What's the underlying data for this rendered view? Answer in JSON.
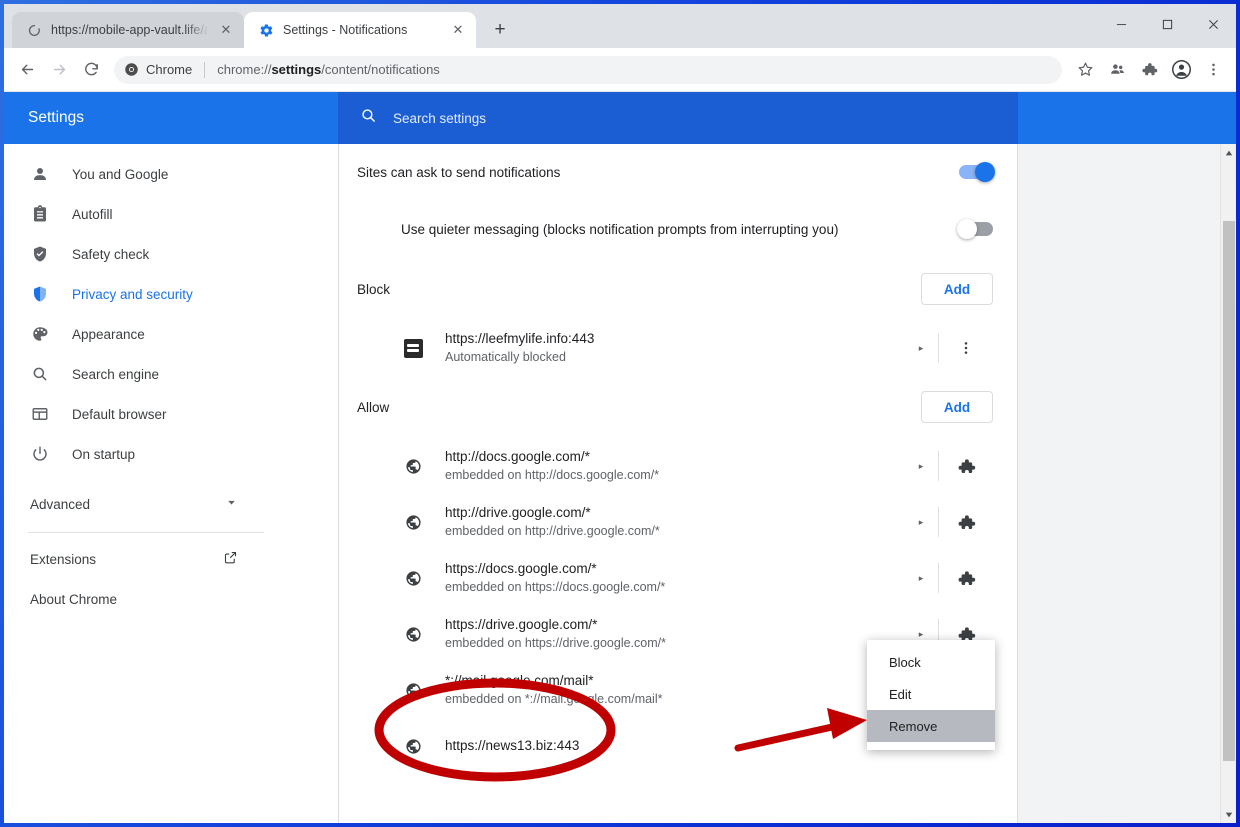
{
  "window": {
    "controls": {
      "minimize": "—",
      "maximize": "☐",
      "close": "✕"
    }
  },
  "tabs": [
    {
      "title": "https://mobile-app-vault.life/aw",
      "favicon": "loading-spinner-icon",
      "active": false,
      "close_label": "✕"
    },
    {
      "title": "Settings - Notifications",
      "favicon": "settings-gear-icon",
      "active": true,
      "close_label": "✕"
    }
  ],
  "new_tab_label": "+",
  "toolbar": {
    "back_icon": "←",
    "forward_icon": "→",
    "reload_icon": "↻",
    "omnibox": {
      "chip_label": "Chrome",
      "url_prefix": "chrome://",
      "url_bold": "settings",
      "url_suffix": "/content/notifications"
    },
    "bookmark_icon": "star-icon",
    "profile_share_icon": "people-icon",
    "extensions_icon": "puzzle-piece-icon",
    "avatar_icon": "avatar-icon",
    "menu_icon": "three-dot-menu-icon"
  },
  "settings_header": {
    "title": "Settings",
    "search_placeholder": "Search settings",
    "search_icon": "search-icon"
  },
  "sidebar": {
    "items": [
      {
        "label": "You and Google",
        "icon": "person-icon",
        "active": false
      },
      {
        "label": "Autofill",
        "icon": "clipboard-icon",
        "active": false
      },
      {
        "label": "Safety check",
        "icon": "shield-check-icon",
        "active": false
      },
      {
        "label": "Privacy and security",
        "icon": "shield-icon",
        "active": true
      },
      {
        "label": "Appearance",
        "icon": "palette-icon",
        "active": false
      },
      {
        "label": "Search engine",
        "icon": "search-icon",
        "active": false
      },
      {
        "label": "Default browser",
        "icon": "browser-window-icon",
        "active": false
      },
      {
        "label": "On startup",
        "icon": "power-icon",
        "active": false
      }
    ],
    "advanced": {
      "label": "Advanced",
      "icon": "chevron-down-icon"
    },
    "links": [
      {
        "label": "Extensions",
        "icon": "external-link-icon"
      },
      {
        "label": "About Chrome",
        "icon": ""
      }
    ]
  },
  "main": {
    "master_toggle": {
      "label": "Sites can ask to send notifications",
      "state": "on"
    },
    "quieter_toggle": {
      "label": "Use quieter messaging (blocks notification prompts from interrupting you)",
      "state": "off"
    },
    "block_section": {
      "title": "Block",
      "add_label": "Add",
      "rows": [
        {
          "site": "https://leefmylife.info:443",
          "sub": "Automatically blocked",
          "favicon": "dark-square-favicon",
          "chevron": "▸",
          "action_icon": "three-dot-menu-icon"
        }
      ]
    },
    "allow_section": {
      "title": "Allow",
      "add_label": "Add",
      "rows": [
        {
          "site": "http://docs.google.com/*",
          "sub": "embedded on http://docs.google.com/*",
          "favicon": "globe-icon",
          "chevron": "▸",
          "action_icon": "puzzle-piece-icon"
        },
        {
          "site": "http://drive.google.com/*",
          "sub": "embedded on http://drive.google.com/*",
          "favicon": "globe-icon",
          "chevron": "▸",
          "action_icon": "puzzle-piece-icon"
        },
        {
          "site": "https://docs.google.com/*",
          "sub": "embedded on https://docs.google.com/*",
          "favicon": "globe-icon",
          "chevron": "▸",
          "action_icon": "puzzle-piece-icon"
        },
        {
          "site": "https://drive.google.com/*",
          "sub": "embedded on https://drive.google.com/*",
          "favicon": "globe-icon",
          "chevron": "▸",
          "action_icon": "puzzle-piece-icon"
        },
        {
          "site": "*://mail.google.com/mail*",
          "sub": "embedded on *://mail.google.com/mail*",
          "favicon": "globe-icon",
          "chevron": "",
          "action_icon": ""
        },
        {
          "site": "https://news13.biz:443",
          "sub": "",
          "favicon": "globe-icon",
          "chevron": "",
          "action_icon": ""
        }
      ]
    }
  },
  "context_menu": {
    "items": [
      {
        "label": "Block",
        "highlighted": false
      },
      {
        "label": "Edit",
        "highlighted": false
      },
      {
        "label": "Remove",
        "highlighted": true
      }
    ]
  },
  "annotations": {
    "ellipse_color": "#c00000",
    "arrow_color": "#c00000"
  }
}
